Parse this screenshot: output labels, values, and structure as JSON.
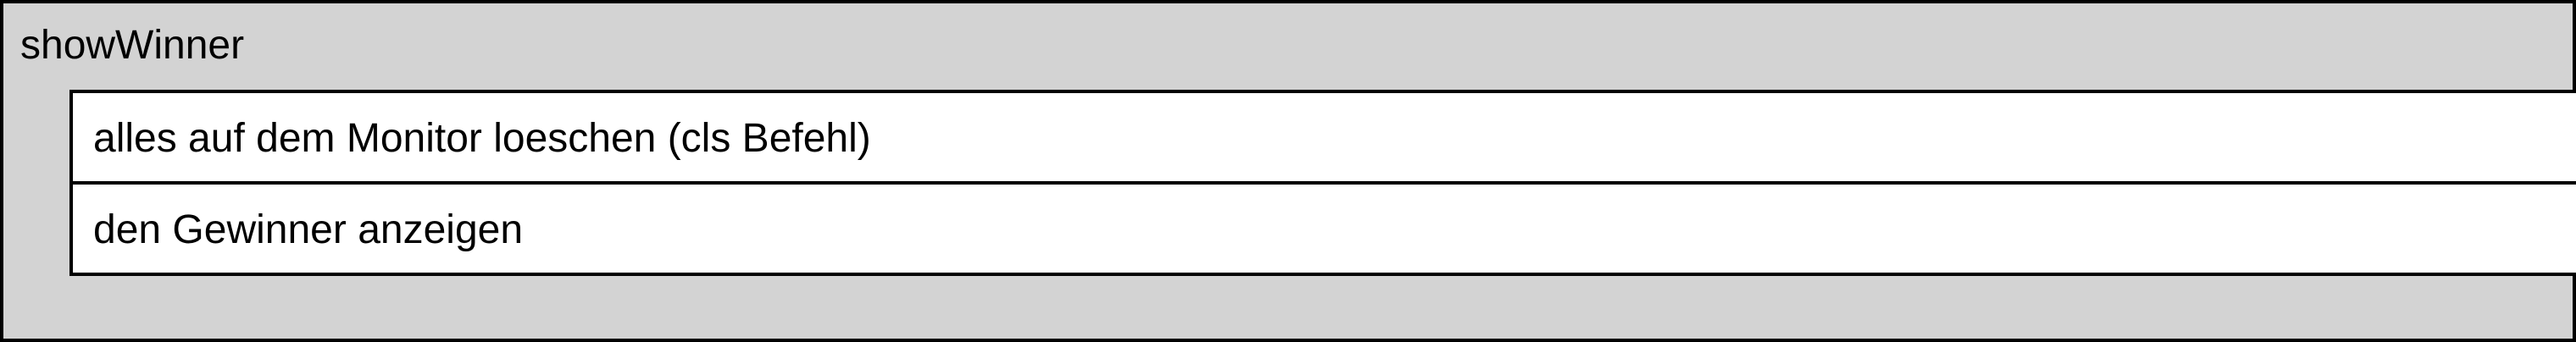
{
  "diagram": {
    "title": "showWinner",
    "steps": [
      "alles auf dem Monitor loeschen (cls Befehl)",
      "den Gewinner anzeigen"
    ]
  }
}
